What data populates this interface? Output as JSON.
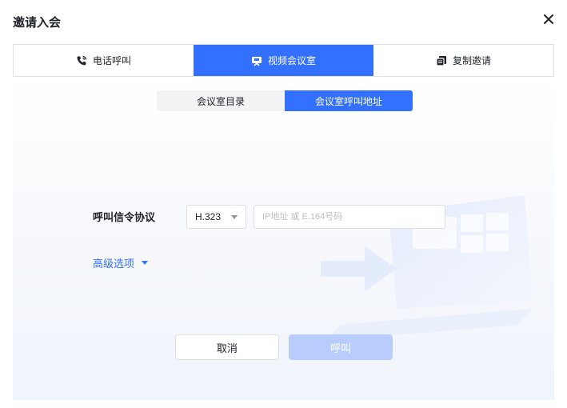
{
  "dialog": {
    "title": "邀请入会"
  },
  "tabs": [
    {
      "label": "电话呼叫",
      "icon": "phone-icon",
      "active": false
    },
    {
      "label": "视频会议室",
      "icon": "meeting-room-icon",
      "active": true
    },
    {
      "label": "复制邀请",
      "icon": "copy-icon",
      "active": false
    }
  ],
  "segment": [
    {
      "label": "会议室目录",
      "active": false
    },
    {
      "label": "会议室呼叫地址",
      "active": true
    }
  ],
  "form": {
    "protocol_label": "呼叫信令协议",
    "protocol_value": "H.323",
    "address_placeholder": "IP地址 或 E.164号码",
    "advanced_label": "高级选项"
  },
  "buttons": {
    "cancel": "取消",
    "call": "呼叫"
  },
  "colors": {
    "accent": "#3370ff",
    "disabled": "#b8cdfd"
  }
}
